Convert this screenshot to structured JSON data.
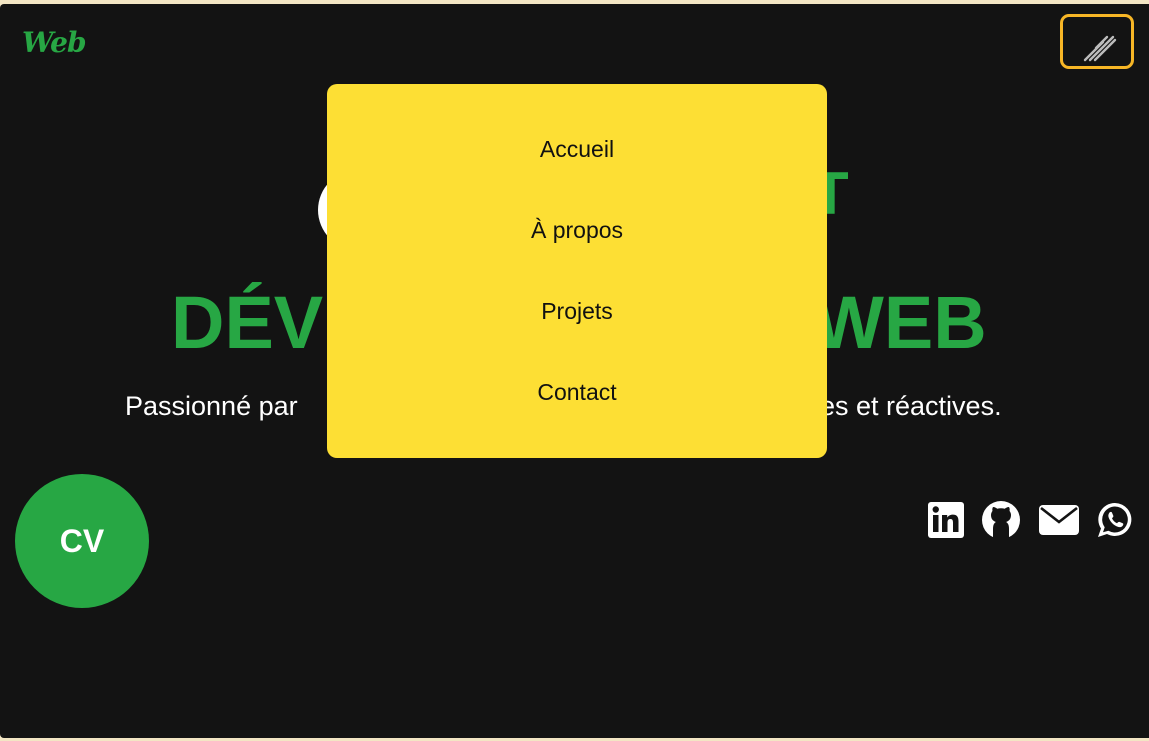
{
  "header": {
    "logo_text": "Web",
    "menu_button_icon": "hamburger-icon"
  },
  "hero": {
    "title_left": "DÉV",
    "title_right": "WEB",
    "heading_fragment": "T",
    "text_left": "Passionné par",
    "text_right": "es et réactives."
  },
  "cv_button": {
    "label": "CV"
  },
  "socials": [
    {
      "name": "LinkedIn",
      "icon": "linkedin-icon"
    },
    {
      "name": "GitHub",
      "icon": "github-icon"
    },
    {
      "name": "Email",
      "icon": "envelope-icon"
    },
    {
      "name": "WhatsApp",
      "icon": "whatsapp-icon"
    }
  ],
  "menu": {
    "items": [
      {
        "label": "Accueil"
      },
      {
        "label": "À propos"
      },
      {
        "label": "Projets"
      },
      {
        "label": "Contact"
      }
    ]
  },
  "colors": {
    "background": "#131313",
    "accent_green": "#27a744",
    "menu_yellow": "#fddf34",
    "button_border": "#f7b626",
    "page_border": "#f3e6c4"
  }
}
